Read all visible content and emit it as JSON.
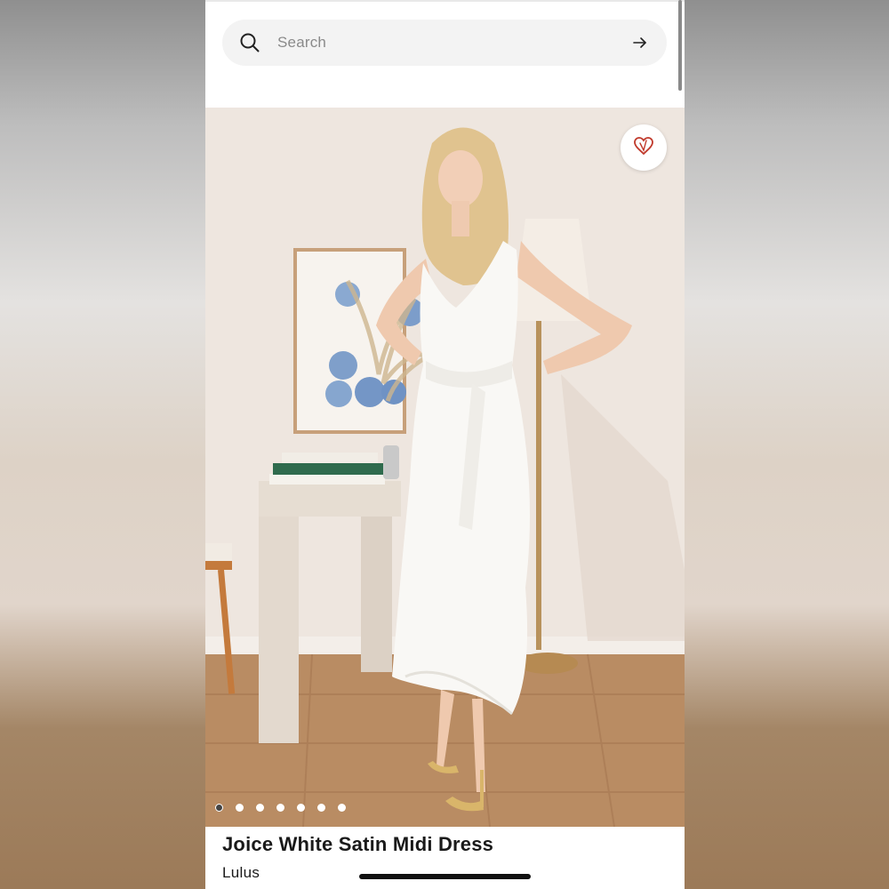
{
  "search": {
    "placeholder": "Search",
    "icon": "search-icon",
    "submit_icon": "arrow-right-icon"
  },
  "product": {
    "title": "Joice White Satin Midi Dress",
    "brand": "Lulus",
    "image_count": 7,
    "active_image_index": 0,
    "favorite_icon": "heart-icon",
    "favorite_color": "#c0392b"
  },
  "colors": {
    "search_background": "#f3f3f3",
    "text": "#1a1a1a"
  }
}
